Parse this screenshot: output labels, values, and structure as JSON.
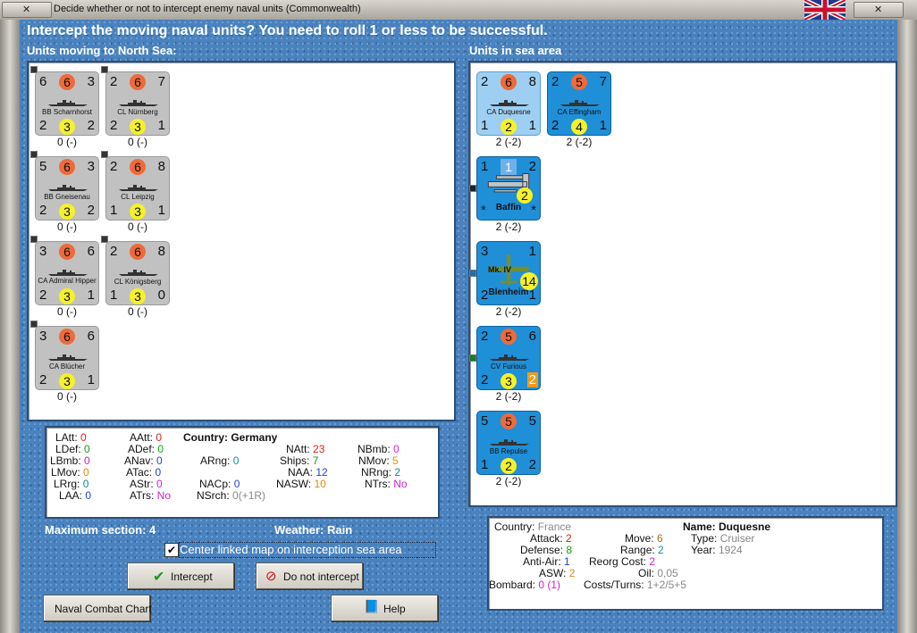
{
  "window": {
    "title": "Decide whether or not to intercept enemy naval units (Commonwealth)"
  },
  "heading": "Intercept the moving naval units?  You need to roll 1 or less to be successful.",
  "left_title": "Units moving to North Sea:",
  "right_title": "Units in sea area",
  "moving_units": [
    {
      "tl": "6",
      "tc": "6",
      "tr": "3",
      "name": "BB Scharnhorst",
      "bl": "2",
      "bc": "3",
      "br": "2",
      "below": "0 (-)"
    },
    {
      "tl": "2",
      "tc": "6",
      "tr": "7",
      "name": "CL Nürnberg",
      "bl": "2",
      "bc": "3",
      "br": "1",
      "below": "0 (-)"
    },
    {
      "tl": "5",
      "tc": "6",
      "tr": "3",
      "name": "BB Gneisenau",
      "bl": "2",
      "bc": "3",
      "br": "2",
      "below": "0 (-)"
    },
    {
      "tl": "2",
      "tc": "6",
      "tr": "8",
      "name": "CL Leipzig",
      "bl": "1",
      "bc": "3",
      "br": "1",
      "below": "0 (-)"
    },
    {
      "tl": "3",
      "tc": "6",
      "tr": "6",
      "name": "CA Admiral Hipper",
      "bl": "2",
      "bc": "3",
      "br": "1",
      "below": "0 (-)"
    },
    {
      "tl": "2",
      "tc": "6",
      "tr": "8",
      "name": "CL Königsberg",
      "bl": "1",
      "bc": "3",
      "br": "0",
      "below": "0 (-)"
    },
    {
      "tl": "3",
      "tc": "6",
      "tr": "6",
      "name": "CA Blücher",
      "bl": "2",
      "bc": "3",
      "br": "1",
      "below": "0 (-)"
    }
  ],
  "sea_units": [
    {
      "tl": "2",
      "tc": "6",
      "tr": "8",
      "name": "CA Duquesne",
      "bl": "1",
      "bc": "2",
      "br": "1",
      "below": "2 (-2)"
    },
    {
      "tl": "2",
      "tc": "5",
      "tr": "7",
      "name": "CA Effingham",
      "bl": "2",
      "bc": "4",
      "br": "1",
      "below": "2 (-2)"
    },
    {
      "tl": "1",
      "tc": "1",
      "tr": "2",
      "name": "Baffin",
      "bl": "*",
      "bc": "2",
      "br": "*",
      "below": "2 (-2)"
    },
    {
      "tl": "3",
      "tc": "",
      "tr": "1",
      "name": "Blenheim",
      "sub": "Mk. IV",
      "bl": "2",
      "bc": "14",
      "br": "1",
      "below": "2 (-2)"
    },
    {
      "tl": "2",
      "tc": "5",
      "tr": "6",
      "name": "CV Furious",
      "bl": "2",
      "bc": "3",
      "br": "2",
      "below": "2 (-2)"
    },
    {
      "tl": "5",
      "tc": "5",
      "tr": "5",
      "name": "BB Repulse",
      "bl": "1",
      "bc": "2",
      "br": "2",
      "below": "2 (-2)"
    }
  ],
  "stats": {
    "latt_l": "LAtt:",
    "latt_v": "0",
    "ldef_l": "LDef:",
    "ldef_v": "0",
    "lbmb_l": "LBmb:",
    "lbmb_v": "0",
    "lmov_l": "LMov:",
    "lmov_v": "0",
    "lrg_l": "LRrg:",
    "lrg_v": "0",
    "laa_l": "LAA:",
    "laa_v": "0",
    "aatt_l": "AAtt:",
    "aatt_v": "0",
    "adef_l": "ADef:",
    "adef_v": "0",
    "anav_l": "ANav:",
    "anav_v": "0",
    "atac_l": "ATac:",
    "atac_v": "0",
    "astr_l": "AStr:",
    "astr_v": "0",
    "atrs_l": "ATrs:",
    "atrs_v": "No",
    "country": "Country: Germany",
    "arng_l": "ARng:",
    "arng_v": "0",
    "nacp_l": "NACp:",
    "nacp_v": "0",
    "nsrch_l": "NSrch:",
    "nsrch_v": "0(+1R)",
    "natt_l": "NAtt:",
    "natt_v": "23",
    "ships_l": "Ships:",
    "ships_v": "7",
    "naa_l": "NAA:",
    "naa_v": "12",
    "nasw_l": "NASW:",
    "nasw_v": "10",
    "nbmb_l": "NBmb:",
    "nbmb_v": "0",
    "nmov_l": "NMov:",
    "nmov_v": "5",
    "nrng_l": "NRng:",
    "nrng_v": "2",
    "ntrs_l": "NTrs:",
    "ntrs_v": "No"
  },
  "max_section": "Maximum section: 4",
  "weather": "Weather:  Rain",
  "center_checkbox": "Center linked map on interception sea area",
  "buttons": {
    "intercept": "Intercept",
    "do_not_intercept": "Do not intercept",
    "naval_chart": "Naval Combat Chart",
    "help": "Help"
  },
  "info": {
    "country_l": "Country:",
    "country_v": "France",
    "name": "Name: Duquesne",
    "attack_l": "Attack:",
    "attack_v": "2",
    "defense_l": "Defense:",
    "defense_v": "8",
    "aa_l": "Anti-Air:",
    "aa_v": "1",
    "asw_l": "ASW:",
    "asw_v": "2",
    "bombard_l": "Bombard:",
    "bombard_v": "0 (1)",
    "move_l": "Move:",
    "move_v": "6",
    "range_l": "Range:",
    "range_v": "2",
    "reorg_l": "Reorg Cost:",
    "reorg_v": "2",
    "oil_l": "Oil:",
    "oil_v": "0,05",
    "costs_l": "Costs/Turns:",
    "costs_v": "1+2/5+5",
    "type_l": "Type:",
    "type_v": "Cruiser",
    "year_l": "Year:",
    "year_v": "1924"
  },
  "colors": {
    "frame": "#4a82be",
    "counter_grey": "#c1c1c1",
    "counter_blue": "#1f8fd8",
    "counter_lightblue": "#9ecff2"
  }
}
